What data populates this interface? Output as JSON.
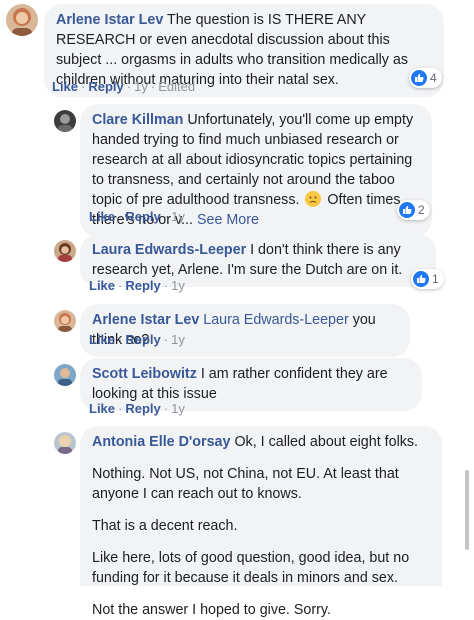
{
  "comments": [
    {
      "author": "Arlene Istar Lev",
      "text": " The question is IS THERE ANY RESEARCH or even anecdotal discussion about this subject ... orgasms in adults who transition medically as children without maturing into their natal sex.",
      "actions": {
        "like": "Like",
        "reply": "Reply",
        "time": "1y",
        "edited": "Edited"
      },
      "reactions": "4"
    },
    {
      "author": "Clare Killman",
      "text": " Unfortunately, you'll come up empty handed trying to find much unbiased research or research at all about idiosyncratic topics pertaining to transness, and certainly not around the taboo topic of pre adulthood transness.",
      "text_after_emoji": " Often times, there's no or v...",
      "see_more": "See More",
      "actions": {
        "like": "Like",
        "reply": "Reply",
        "time": "1y"
      },
      "reactions": "2"
    },
    {
      "author": "Laura Edwards-Leeper",
      "text": " I don't think there is any research yet, Arlene. I'm sure the Dutch are on it.",
      "actions": {
        "like": "Like",
        "reply": "Reply",
        "time": "1y"
      },
      "reactions": "1"
    },
    {
      "author": "Arlene Istar Lev",
      "mention": "Laura Edwards-Leeper",
      "text": " you think so?",
      "actions": {
        "like": "Like",
        "reply": "Reply",
        "time": "1y"
      }
    },
    {
      "author": "Scott Leibowitz",
      "text": " I am rather confident they are looking at this issue",
      "actions": {
        "like": "Like",
        "reply": "Reply",
        "time": "1y"
      }
    },
    {
      "author": "Antonia Elle D'orsay",
      "text": " Ok, I called about eight folks.",
      "paragraphs": [
        "Nothing. Not US, not China, not EU. At least that anyone I can reach out to knows.",
        "That is a decent reach.",
        "Like here, lots of good question, good idea, but no funding for it because it deals in minors and sex.",
        "Not the answer I hoped to give. Sorry."
      ]
    }
  ],
  "separator": "·",
  "icons": {
    "reaction": "like-icon",
    "emoji": "sad-face-emoji"
  },
  "colors": {
    "link": "#385898",
    "bubble": "#f2f3f5",
    "like_blue": "#2078f4",
    "muted": "#90949c"
  }
}
